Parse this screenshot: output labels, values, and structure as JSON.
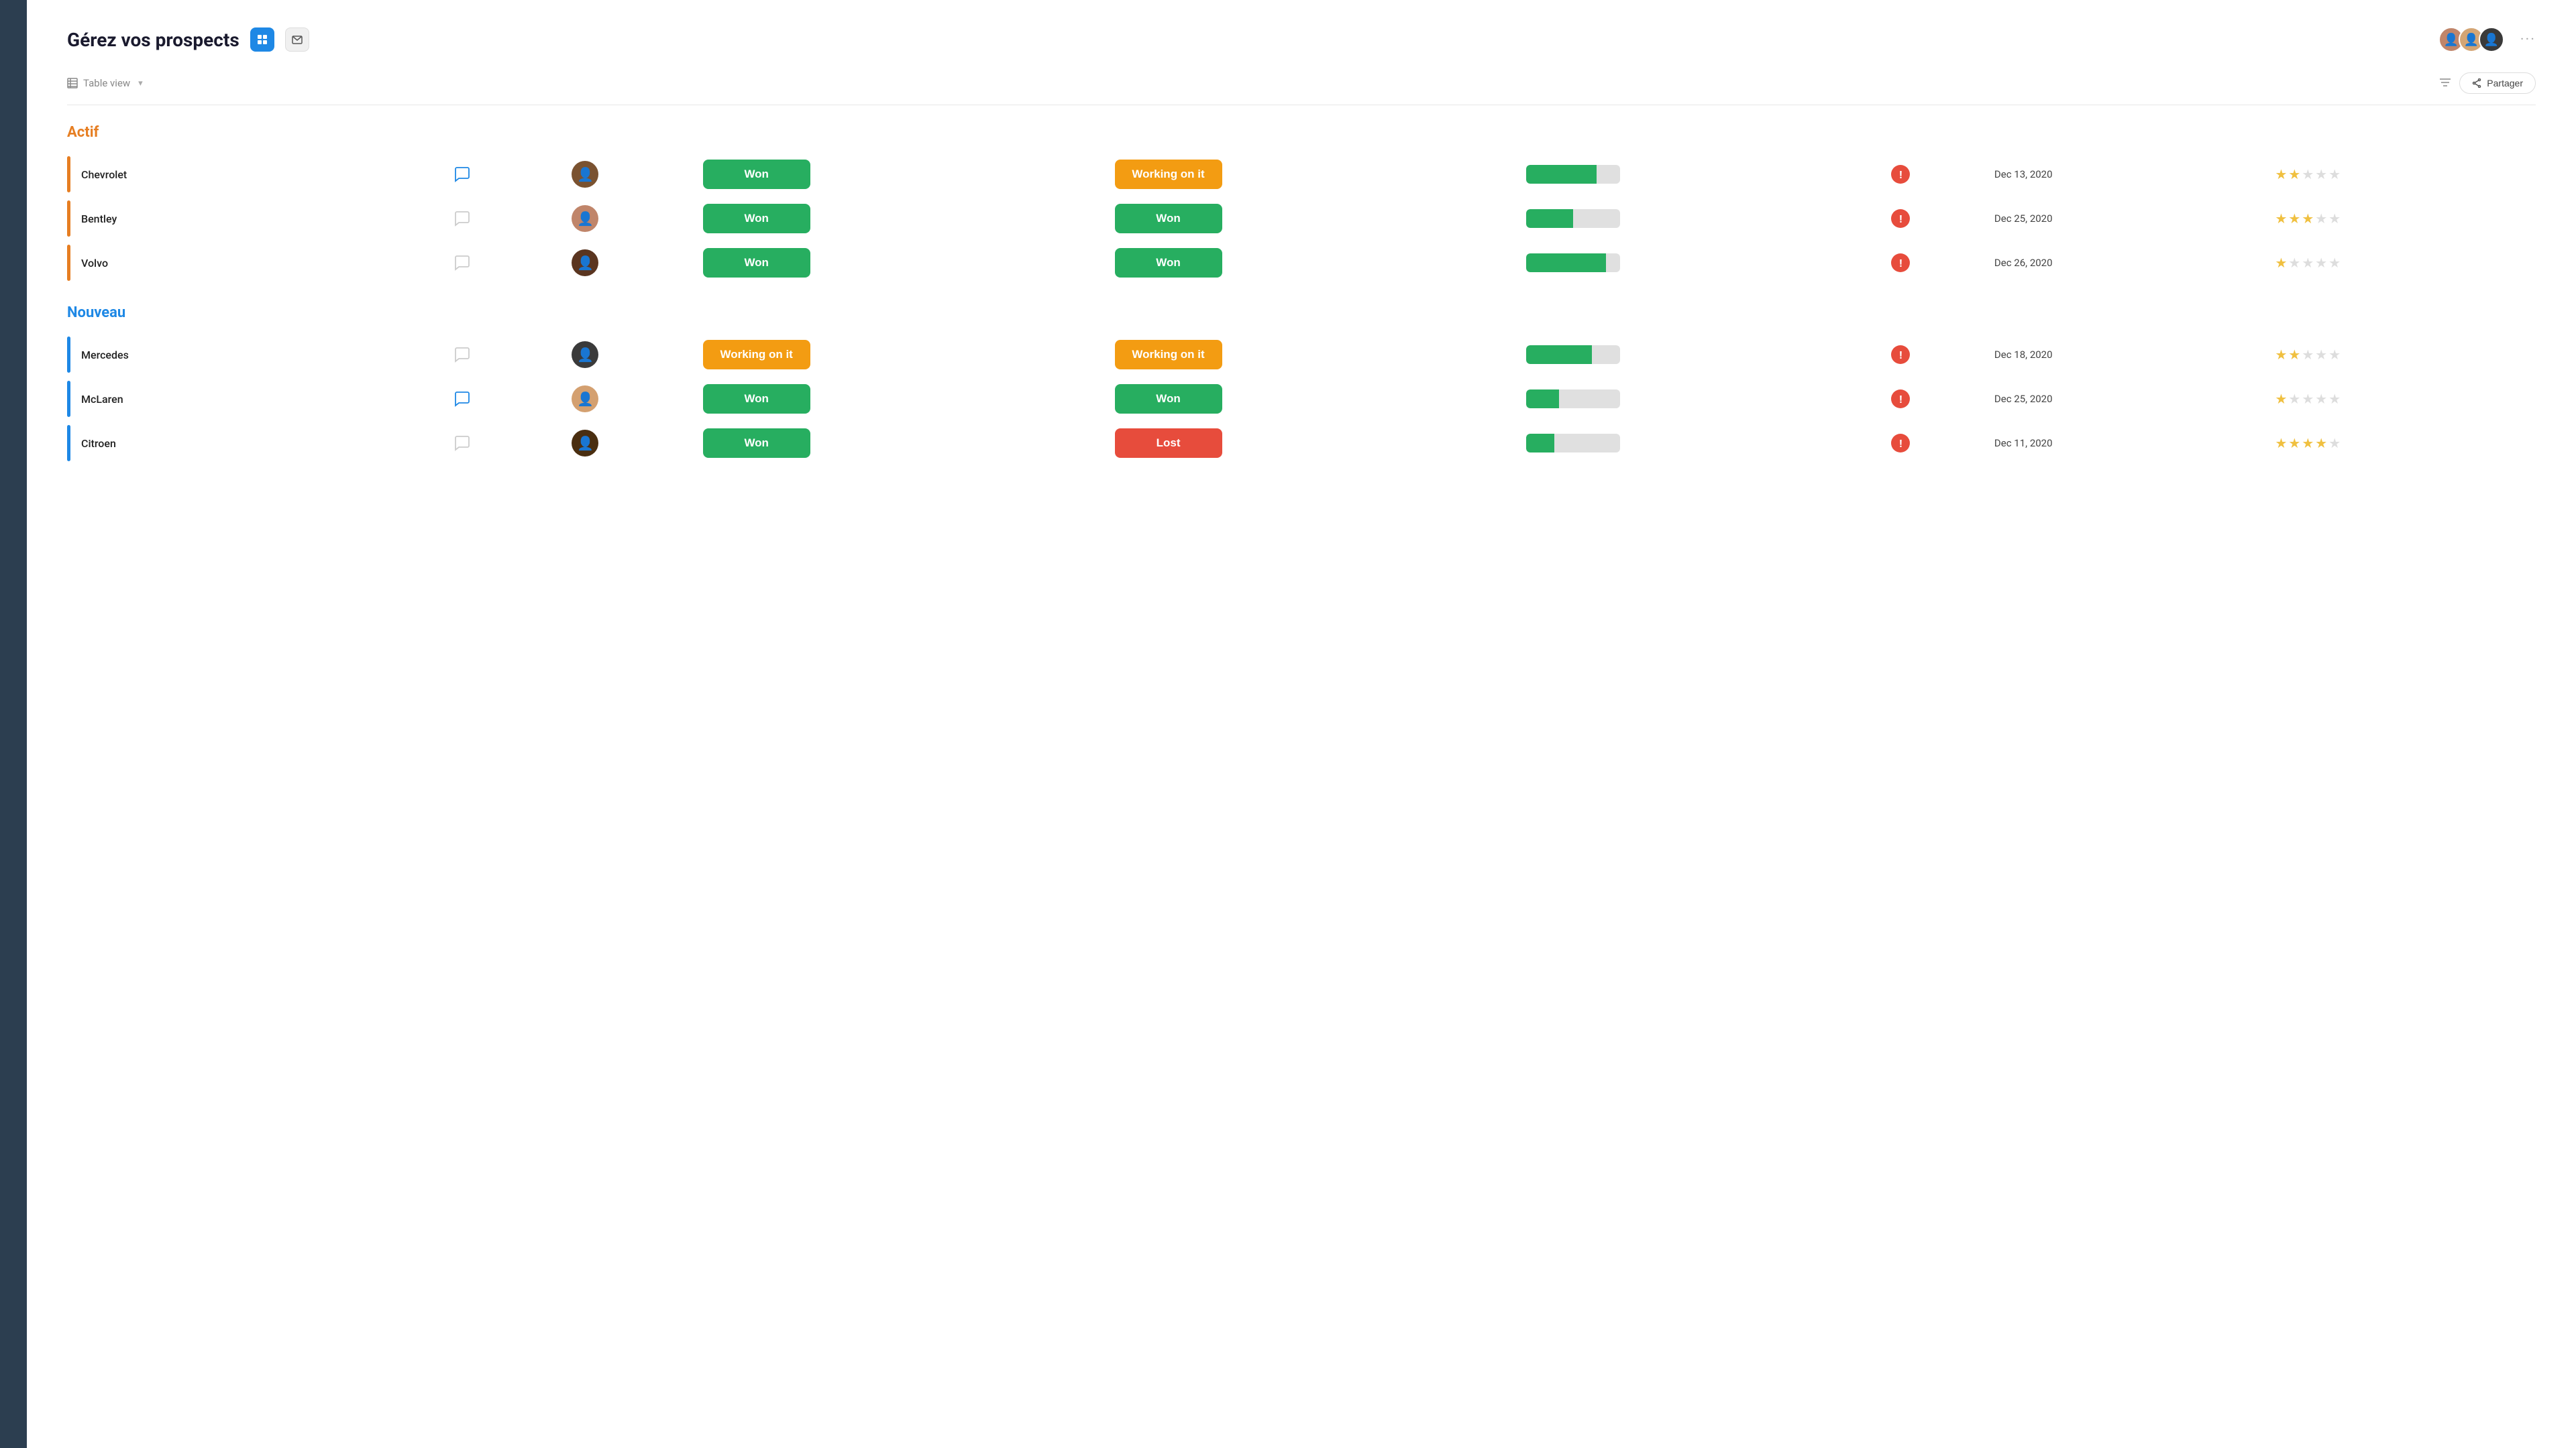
{
  "sidebar": {},
  "header": {
    "title": "Gérez vos prospects",
    "icon_table": "⊞",
    "icon_mail": "✉",
    "more_label": "···",
    "share_label": "Partager",
    "filter_label": "Filtres"
  },
  "toolbar": {
    "table_view_label": "Table view"
  },
  "sections": [
    {
      "id": "actif",
      "label": "Actif",
      "color_class": "actif",
      "border_class": "orange",
      "rows": [
        {
          "id": "chevrolet",
          "company": "Chevrolet",
          "chat_active": true,
          "avatar_class": "face-1",
          "avatar_char": "👤",
          "status1": "Won",
          "status1_color": "green",
          "status2": "Working on it",
          "status2_color": "orange",
          "progress": 75,
          "date": "Dec 13, 2020",
          "stars": 2,
          "total_stars": 5
        },
        {
          "id": "bentley",
          "company": "Bentley",
          "chat_active": false,
          "avatar_class": "face-2",
          "avatar_char": "👤",
          "status1": "Won",
          "status1_color": "green",
          "status2": "Won",
          "status2_color": "green",
          "progress": 50,
          "date": "Dec 25, 2020",
          "stars": 3,
          "total_stars": 5
        },
        {
          "id": "volvo",
          "company": "Volvo",
          "chat_active": false,
          "avatar_class": "face-3",
          "avatar_char": "👤",
          "status1": "Won",
          "status1_color": "green",
          "status2": "Won",
          "status2_color": "green",
          "progress": 85,
          "date": "Dec 26, 2020",
          "stars": 1,
          "total_stars": 5
        }
      ]
    },
    {
      "id": "nouveau",
      "label": "Nouveau",
      "color_class": "nouveau",
      "border_class": "blue",
      "rows": [
        {
          "id": "mercedes",
          "company": "Mercedes",
          "chat_active": false,
          "avatar_class": "face-4",
          "avatar_char": "👤",
          "status1": "Working on it",
          "status1_color": "orange",
          "status2": "Working on it",
          "status2_color": "orange",
          "progress": 70,
          "date": "Dec 18, 2020",
          "stars": 2,
          "total_stars": 5
        },
        {
          "id": "mclaren",
          "company": "McLaren",
          "chat_active": true,
          "avatar_class": "face-5",
          "avatar_char": "👤",
          "status1": "Won",
          "status1_color": "green",
          "status2": "Won",
          "status2_color": "green",
          "progress": 35,
          "date": "Dec 25, 2020",
          "stars": 1,
          "total_stars": 5
        },
        {
          "id": "citroen",
          "company": "Citroen",
          "chat_active": false,
          "avatar_class": "face-6",
          "avatar_char": "👤",
          "status1": "Won",
          "status1_color": "green",
          "status2": "Lost",
          "status2_color": "red",
          "progress": 30,
          "date": "Dec 11, 2020",
          "stars": 4,
          "total_stars": 5
        }
      ]
    }
  ]
}
